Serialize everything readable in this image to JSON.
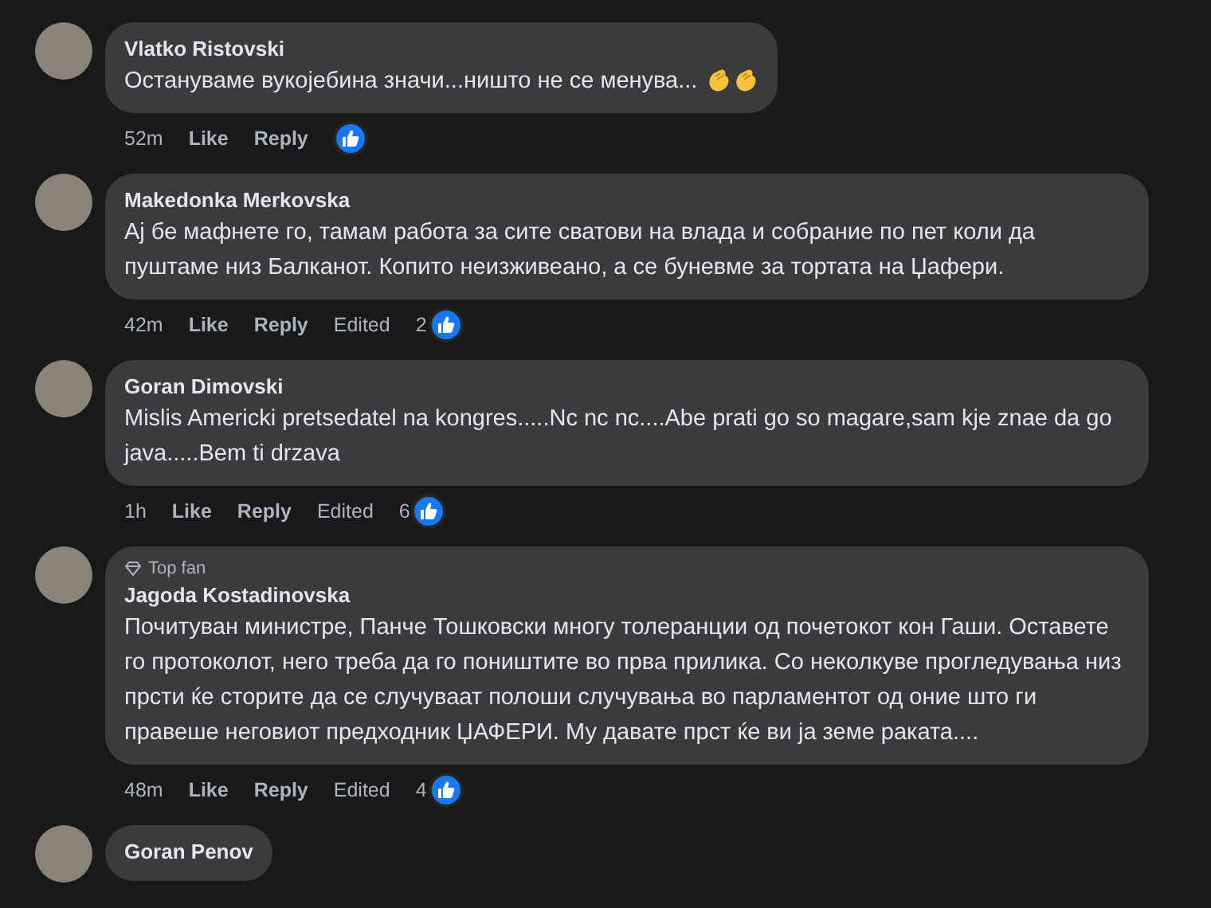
{
  "comments": [
    {
      "author": "Vlatko Ristovski",
      "text": "Остануваме вукојебина значи...ништо не се менува...",
      "emojis": [
        {
          "kind": "clap"
        },
        {
          "kind": "clap"
        }
      ],
      "time": "52m",
      "like": "Like",
      "reply": "Reply"
    },
    {
      "author": "Makedonka Merkovska",
      "text": "Ај бе мафнете го, тамам работа за сите сватови на влада и собрание по пет коли да пуштаме низ Балканот. Копито неизживеано, а се буневме за тортата на Џафери.",
      "time": "42m",
      "like": "Like",
      "reply": "Reply",
      "edited": "Edited",
      "reaction_count": "2"
    },
    {
      "author": "Goran Dimovski",
      "text": "Mislis Americki pretsedatel na kongres.....Nc nc nc....Abe prati go so magare,sam kje znae da go java.....Bem ti drzava",
      "time": "1h",
      "like": "Like",
      "reply": "Reply",
      "edited": "Edited",
      "reaction_count": "6"
    },
    {
      "author": "Jagoda Kostadinovska",
      "badge": "Top fan",
      "text": "Почитуван министре, Панче Тошковски многу толеранции од почетокот кон Гаши. Оставете го протоколот, него треба да го поништите во прва прилика. Со неколкуве прогледувања низ прсти ќе сторите да се случуваат полоши случувања во парламентот од оние што ги правеше неговиот предходник ЏАФЕРИ. Му давате прст ќе ви ја земе раката....",
      "time": "48m",
      "like": "Like",
      "reply": "Reply",
      "edited": "Edited",
      "reaction_count": "4"
    },
    {
      "author": "Goran Penov"
    }
  ]
}
